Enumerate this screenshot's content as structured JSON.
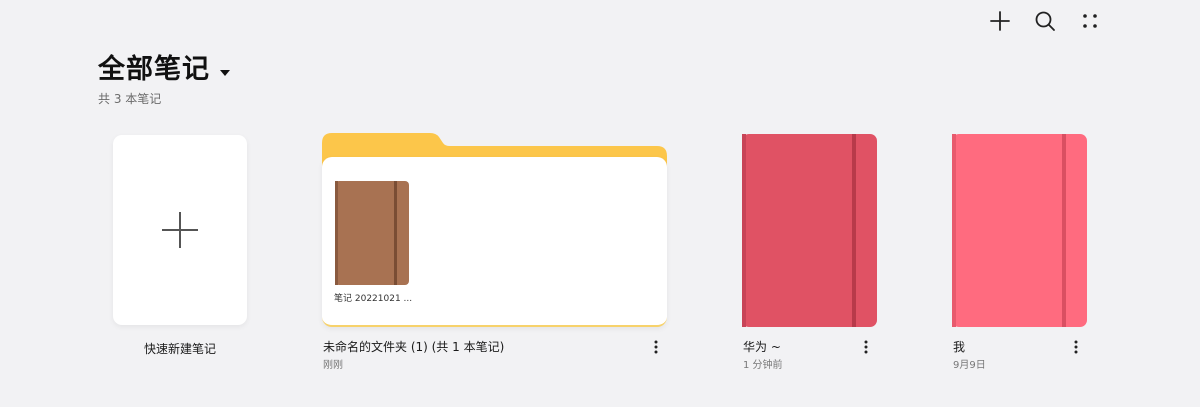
{
  "header": {
    "title": "全部笔记",
    "subtitle": "共 3 本笔记"
  },
  "toolbar": {
    "icons": [
      "plus-icon",
      "search-icon",
      "more-grid-icon"
    ]
  },
  "quick_create": {
    "label": "快速新建笔记"
  },
  "folder": {
    "name": "未命名的文件夹 (1) (共 1 本笔记)",
    "time": "刚刚",
    "inner_note_label": "笔记 20221021 ...",
    "inner_note_color": "#a87252",
    "tab_color": "#fcc64a"
  },
  "notebooks": [
    {
      "title": "华为 ~",
      "time": "1 分钟前",
      "color": "#e05264",
      "band": "#b83a4a"
    },
    {
      "title": "我",
      "time": "9月9日",
      "color": "#ff6b7f",
      "band": "#d94f62"
    }
  ],
  "colors": {
    "background": "#f2f2f4",
    "card": "#ffffff"
  }
}
